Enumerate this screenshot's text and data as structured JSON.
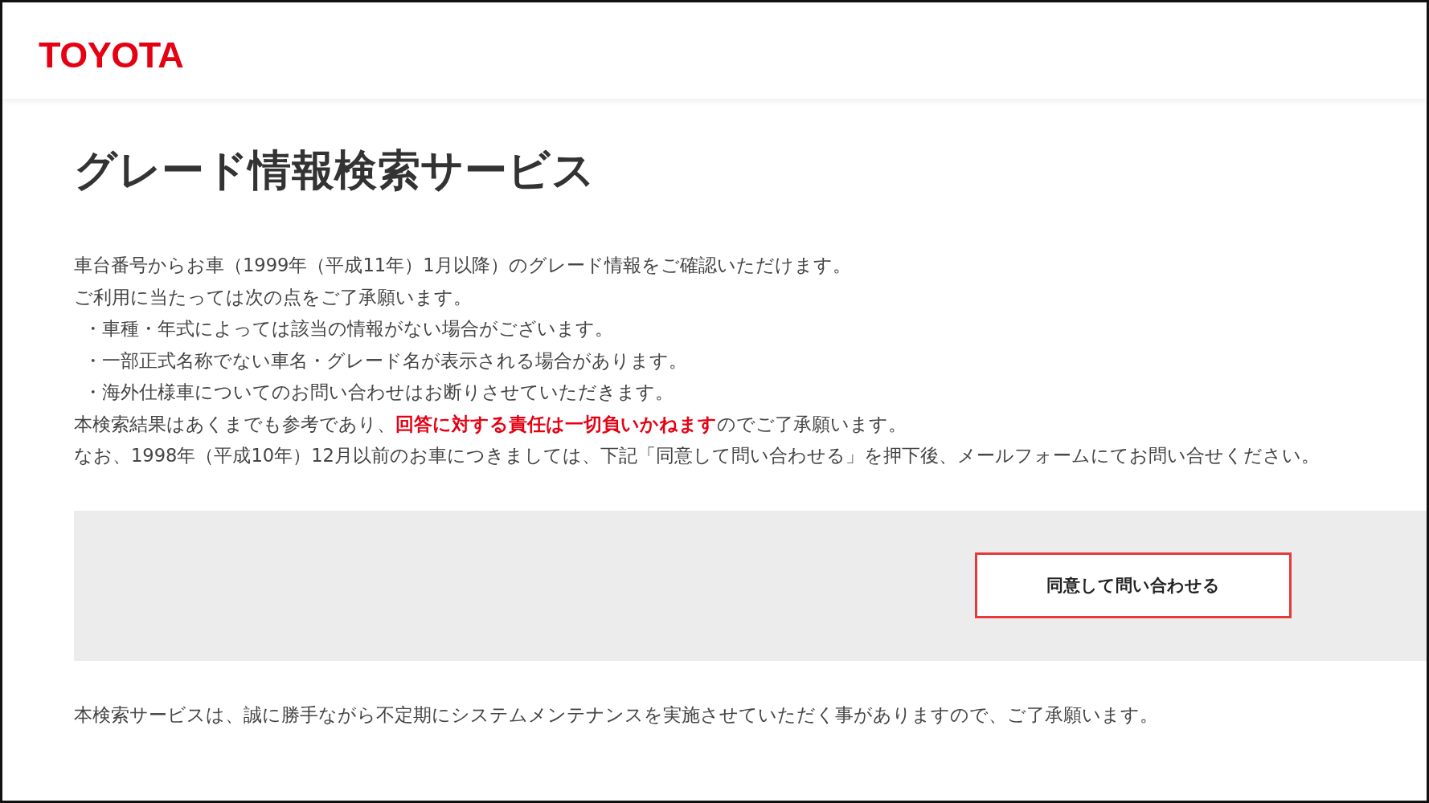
{
  "header": {
    "logo": "TOYOTA"
  },
  "main": {
    "title": "グレード情報検索サービス",
    "intro": [
      "車台番号からお車（1999年（平成11年）1月以降）のグレード情報をご確認いただけます。",
      "ご利用に当たっては次の点をご了承願います。"
    ],
    "notes": [
      "・車種・年式によっては該当の情報がない場合がございます。",
      "・一部正式名称でない車名・グレード名が表示される場合があります。",
      "・海外仕様車についてのお問い合わせはお断りさせていただきます。"
    ],
    "disclaimer": "本検索結果はあくまでも参考であり、**回答に対する責任は一切負いかねます**のでご了承願います。",
    "older_cars": "なお、1998年（平成10年）12月以前のお車につきましては、下記「同意して問い合わせる」を押下後、メールフォームにてお問い合せください。",
    "agree_button": "同意して問い合わせる",
    "maintenance_notice": "本検索サービスは、誠に勝手ながら不定期にシステムメンテナンスを実施させていただく事がありますので、ご了承願います。"
  }
}
